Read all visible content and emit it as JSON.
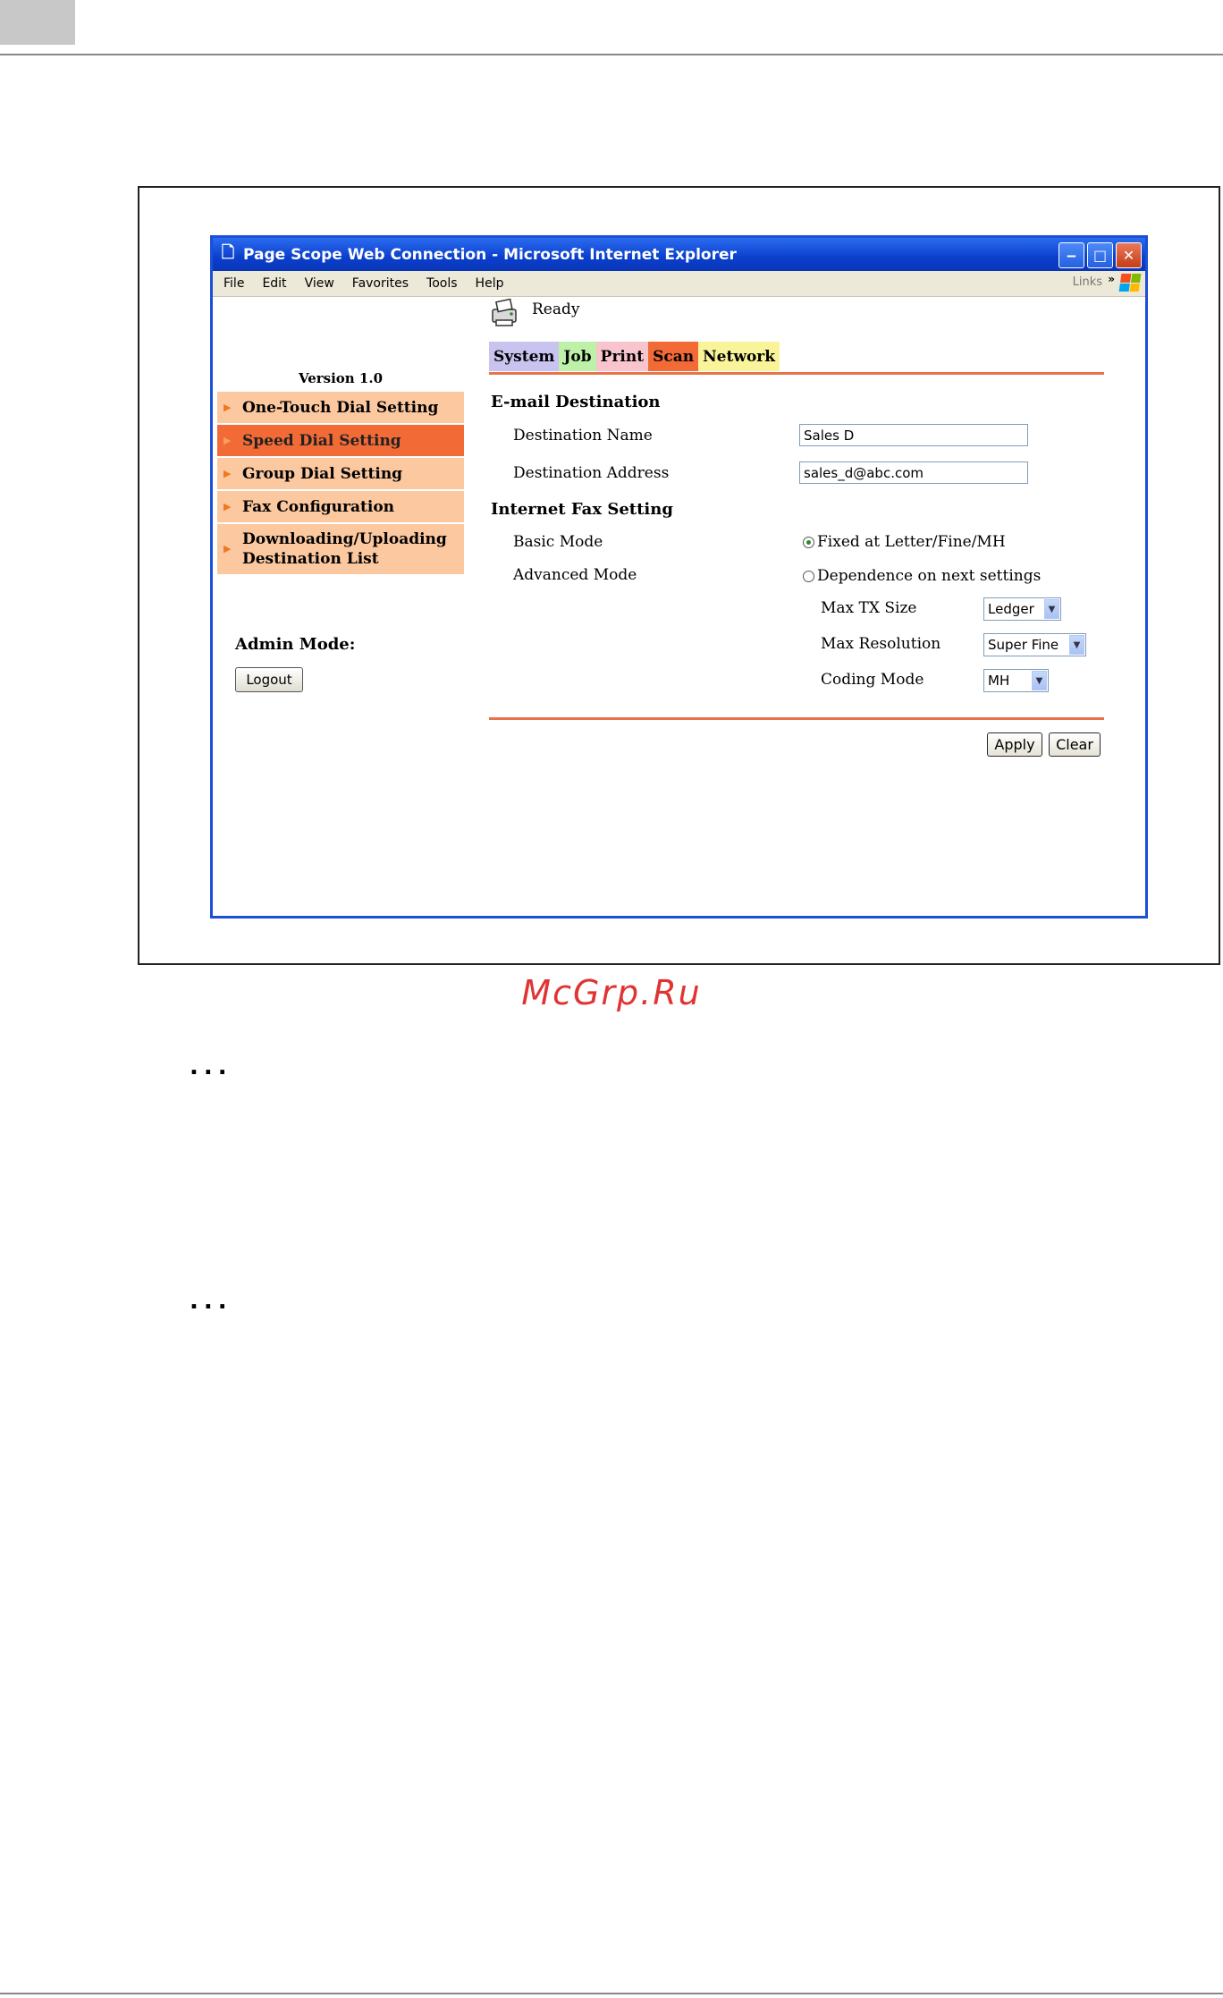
{
  "watermark": "McGrp.Ru",
  "note_marker": "...",
  "window": {
    "title": "Page Scope Web Connection - Microsoft Internet Explorer",
    "menu": [
      "File",
      "Edit",
      "View",
      "Favorites",
      "Tools",
      "Help"
    ],
    "links_label": "Links",
    "links_chevron": "»"
  },
  "sidebar": {
    "version": "Version 1.0",
    "items": [
      {
        "label": "One-Touch Dial Setting",
        "active": false
      },
      {
        "label": "Speed Dial Setting",
        "active": true
      },
      {
        "label": "Group Dial Setting",
        "active": false
      },
      {
        "label": "Fax Configuration",
        "active": false
      },
      {
        "label": "Downloading/Uploading Destination List",
        "active": false
      }
    ],
    "admin_label": "Admin Mode:",
    "logout_label": "Logout"
  },
  "status": "Ready",
  "tabs": [
    {
      "label": "System",
      "color": "#c9c3f0"
    },
    {
      "label": "Job",
      "color": "#bdf0a8"
    },
    {
      "label": "Print",
      "color": "#f8c4cd"
    },
    {
      "label": "Scan",
      "color": "#f26a35"
    },
    {
      "label": "Network",
      "color": "#f9f39a"
    }
  ],
  "form": {
    "email_section": "E-mail Destination",
    "dest_name_label": "Destination Name",
    "dest_name_value": "Sales D",
    "dest_address_label": "Destination Address",
    "dest_address_value": "sales_d@abc.com",
    "ifax_section": "Internet Fax Setting",
    "basic_mode_label": "Basic Mode",
    "basic_mode_option": "Fixed at Letter/Fine/MH",
    "advanced_mode_label": "Advanced Mode",
    "advanced_mode_option": "Dependence on next settings",
    "max_tx_label": "Max TX Size",
    "max_tx_value": "Ledger",
    "max_res_label": "Max Resolution",
    "max_res_value": "Super Fine",
    "coding_label": "Coding Mode",
    "coding_value": "MH",
    "apply_label": "Apply",
    "clear_label": "Clear"
  }
}
